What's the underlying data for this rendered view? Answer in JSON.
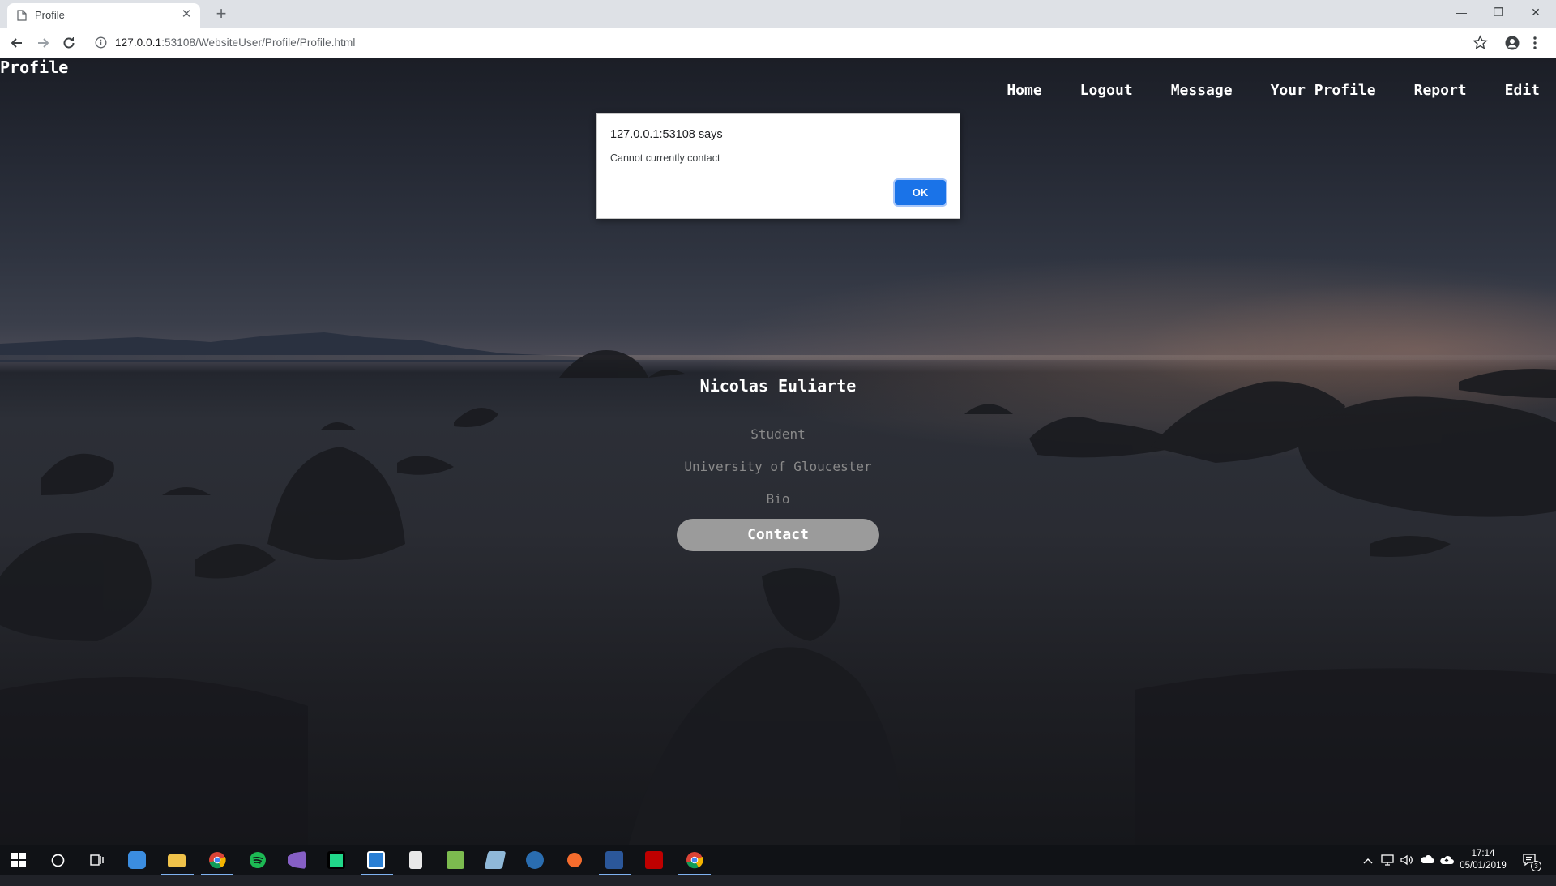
{
  "browser": {
    "tab_title": "Profile",
    "tab_close": "✕",
    "new_tab": "+",
    "window_controls": {
      "minimize": "—",
      "restore": "❐",
      "close": "✕"
    },
    "url_host": "127.0.0.1",
    "url_rest": ":53108/WebsiteUser/Profile/Profile.html"
  },
  "site": {
    "title": "Profile",
    "nav": [
      "Home",
      "Logout",
      "Message",
      "Your Profile",
      "Report",
      "Edit"
    ]
  },
  "profile": {
    "name": "Nicolas Euliarte",
    "role": "Student",
    "university": "University of Gloucester",
    "bio": "Bio",
    "contact_label": "Contact"
  },
  "dialog": {
    "title": "127.0.0.1:53108 says",
    "message": "Cannot currently contact",
    "ok_label": "OK"
  },
  "taskbar": {
    "apps": [
      "start-icon",
      "search-icon",
      "task-view-icon",
      "store-icon",
      "file-explorer-icon",
      "chrome-icon",
      "spotify-icon",
      "visual-studio-icon",
      "pycharm-icon",
      "app-icon",
      "notepad-icon",
      "spreadsheet-icon",
      "edit-icon",
      "steam-icon",
      "origin-icon",
      "word-icon",
      "filezilla-icon",
      "chrome-icon-2"
    ],
    "time": "17:14",
    "date": "05/01/2019",
    "notification_count": "3"
  },
  "colors": {
    "accent": "#1a73e8",
    "contact_button": "#9b9b9b"
  }
}
